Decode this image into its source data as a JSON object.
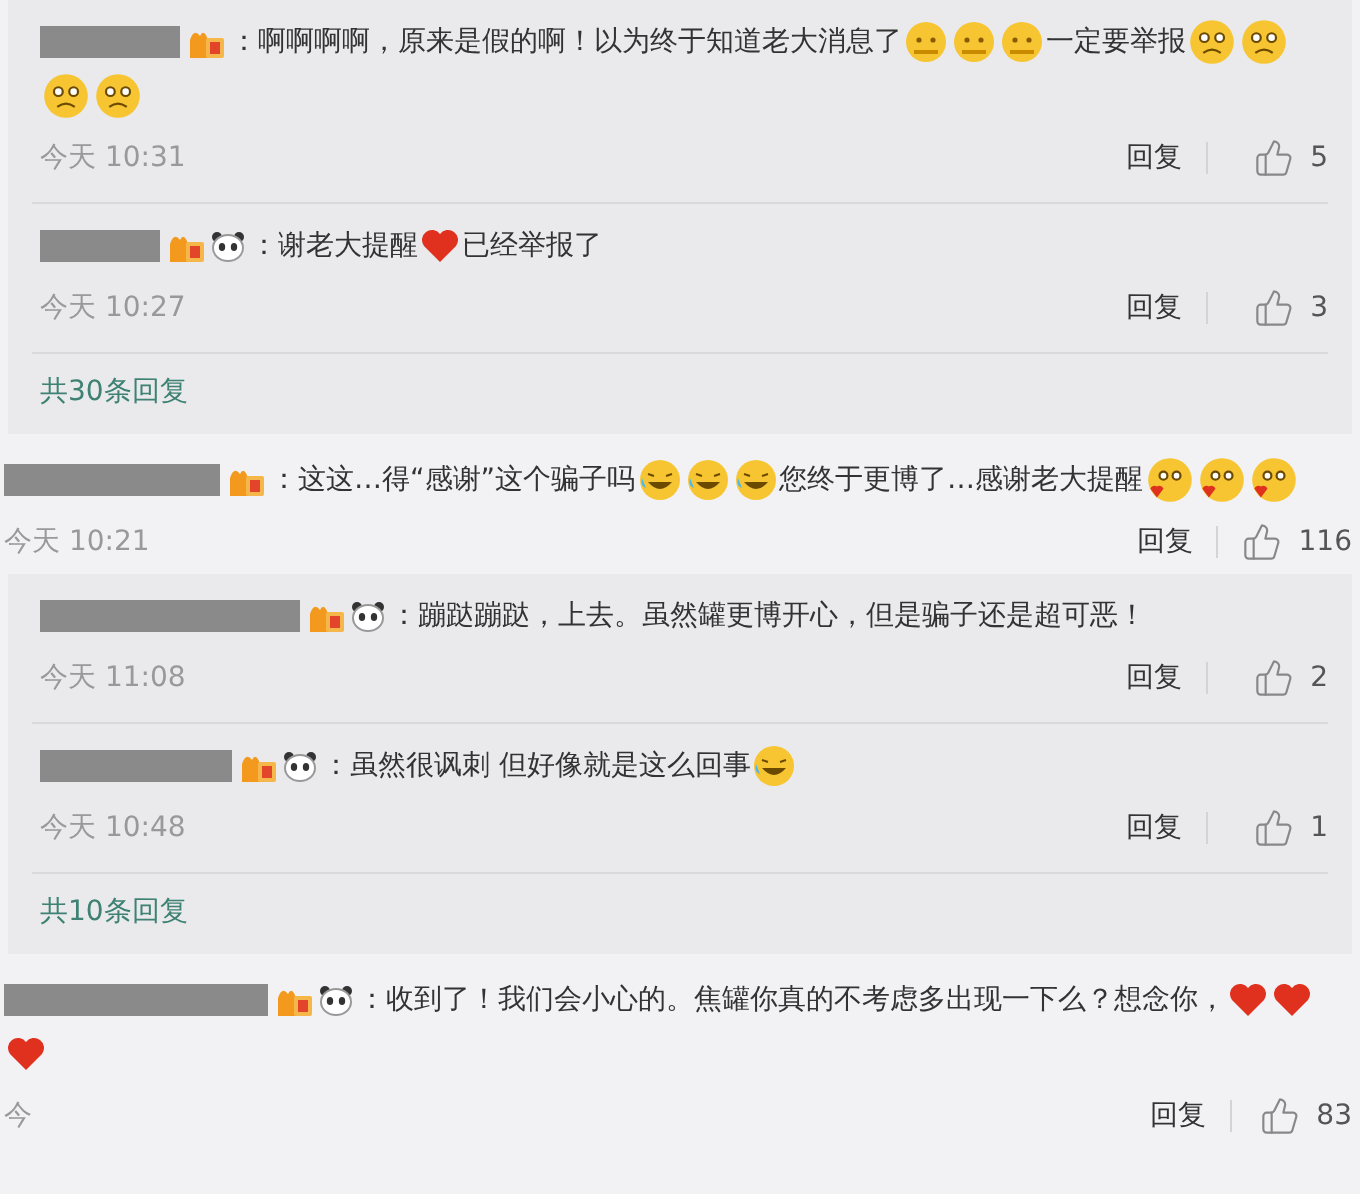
{
  "items": [
    {
      "kind": "replies",
      "replies": [
        {
          "badges": [
            {
              "kind": "level"
            }
          ],
          "segments": [
            {
              "kind": "text",
              "text": "：啊啊啊啊，原来是假的啊！以为终于知道老大消息了"
            },
            {
              "kind": "worried"
            },
            {
              "kind": "worried"
            },
            {
              "kind": "worried"
            },
            {
              "kind": "text",
              "text": "一定要举报"
            },
            {
              "kind": "sad"
            },
            {
              "kind": "sad"
            },
            {
              "kind": "sad"
            },
            {
              "kind": "sad"
            }
          ],
          "time": "今天 10:31",
          "reply": "回复",
          "likes": "5"
        },
        {
          "badges": [
            {
              "kind": "level"
            },
            {
              "kind": "panda"
            }
          ],
          "segments": [
            {
              "kind": "text",
              "text": "：谢老大提醒"
            },
            {
              "kind": "heart"
            },
            {
              "kind": "text",
              "text": "已经举报了"
            }
          ],
          "time": "今天 10:27",
          "reply": "回复",
          "likes": "3"
        }
      ],
      "more": "共30条回复"
    },
    {
      "kind": "comment",
      "badges": [
        {
          "kind": "level"
        }
      ],
      "segments": [
        {
          "kind": "text",
          "text": "：这这…得“感谢”这个骗子吗"
        },
        {
          "kind": "laugh"
        },
        {
          "kind": "laugh"
        },
        {
          "kind": "laugh"
        },
        {
          "kind": "text",
          "text": "您终于更博了…感谢老大提醒"
        },
        {
          "kind": "blush"
        },
        {
          "kind": "blush"
        },
        {
          "kind": "blush"
        }
      ],
      "time": "今天 10:21",
      "reply": "回复",
      "likes": "116"
    },
    {
      "kind": "replies",
      "replies": [
        {
          "badges": [
            {
              "kind": "level"
            },
            {
              "kind": "panda"
            }
          ],
          "segments": [
            {
              "kind": "text",
              "text": "：蹦跶蹦跶，上去。虽然罐更博开心，但是骗子还是超可恶！"
            }
          ],
          "time": "今天 11:08",
          "reply": "回复",
          "likes": "2"
        },
        {
          "badges": [
            {
              "kind": "level"
            },
            {
              "kind": "panda"
            }
          ],
          "segments": [
            {
              "kind": "text",
              "text": "：虽然很讽刺 但好像就是这么回事"
            },
            {
              "kind": "laugh"
            }
          ],
          "time": "今天 10:48",
          "reply": "回复",
          "likes": "1"
        }
      ],
      "more": "共10条回复"
    },
    {
      "kind": "comment",
      "badges": [
        {
          "kind": "level"
        },
        {
          "kind": "panda"
        }
      ],
      "segments": [
        {
          "kind": "text",
          "text": "：收到了！我们会小心的。焦罐你真的不考虑多出现一下么？想念你，"
        },
        {
          "kind": "heart"
        },
        {
          "kind": "heart"
        },
        {
          "kind": "heart"
        }
      ],
      "time": "今",
      "reply": "回复",
      "likes": "83"
    }
  ]
}
